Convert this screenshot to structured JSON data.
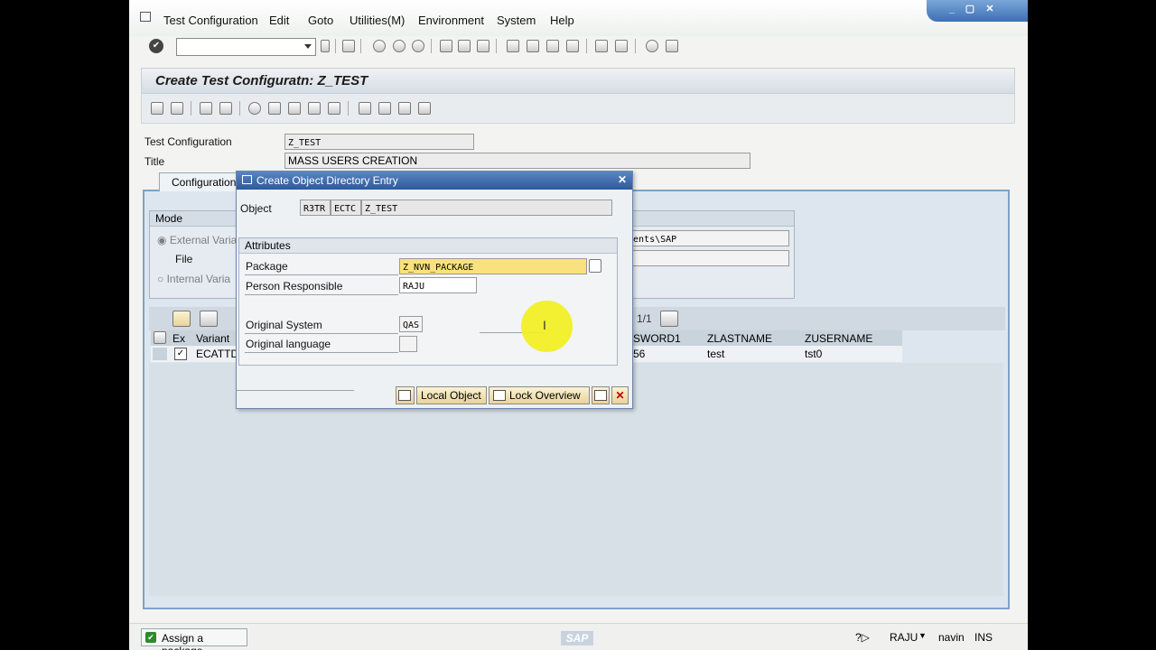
{
  "menu": {
    "items": [
      "Test Configuration",
      "Edit",
      "Goto",
      "Utilities(M)",
      "Environment",
      "System",
      "Help"
    ]
  },
  "window_controls": {
    "minimize": "_",
    "restore": "▢",
    "close": "✕"
  },
  "page": {
    "title": "Create Test Configuratn: Z_TEST"
  },
  "form": {
    "test_configuration_label": "Test Configuration",
    "test_configuration_value": "Z_TEST",
    "title_label": "Title",
    "title_value": "MASS USERS CREATION"
  },
  "tab": {
    "label": "Configuration"
  },
  "mode_group": {
    "header": "Mode",
    "external_label": "External Varia",
    "file_label": "File",
    "internal_label": "Internal Varia",
    "path_value": "ments\\SAP"
  },
  "table": {
    "pager": "1/1",
    "headers": [
      "Ex",
      "Variant",
      "SWORD1",
      "ZLASTNAME",
      "ZUSERNAME"
    ],
    "row": {
      "variant": "ECATTD",
      "sword1": "56",
      "zlastname": "test",
      "zusername": "tst0"
    }
  },
  "dialog": {
    "title": "Create Object Directory Entry",
    "object_label": "Object",
    "object_pgmid": "R3TR",
    "object_type": "ECTC",
    "object_name": "Z_TEST",
    "attributes_header": "Attributes",
    "package_label": "Package",
    "package_value": "Z_NVN_PACKAGE",
    "person_label": "Person Responsible",
    "person_value": "RAJU",
    "orig_system_label": "Original System",
    "orig_system_value": "QAS",
    "orig_lang_label": "Original language",
    "orig_lang_value": "",
    "local_object_label": "Local Object",
    "lock_overview_label": "Lock Overview"
  },
  "status": {
    "message": "Assign a package",
    "logo": "SAP",
    "user": "RAJU",
    "client": "navin",
    "mode": "INS"
  },
  "colors": {
    "accent": "#2e5a9b",
    "package_highlight": "#f9e27d",
    "cursor_halo": "#f2f01c"
  }
}
